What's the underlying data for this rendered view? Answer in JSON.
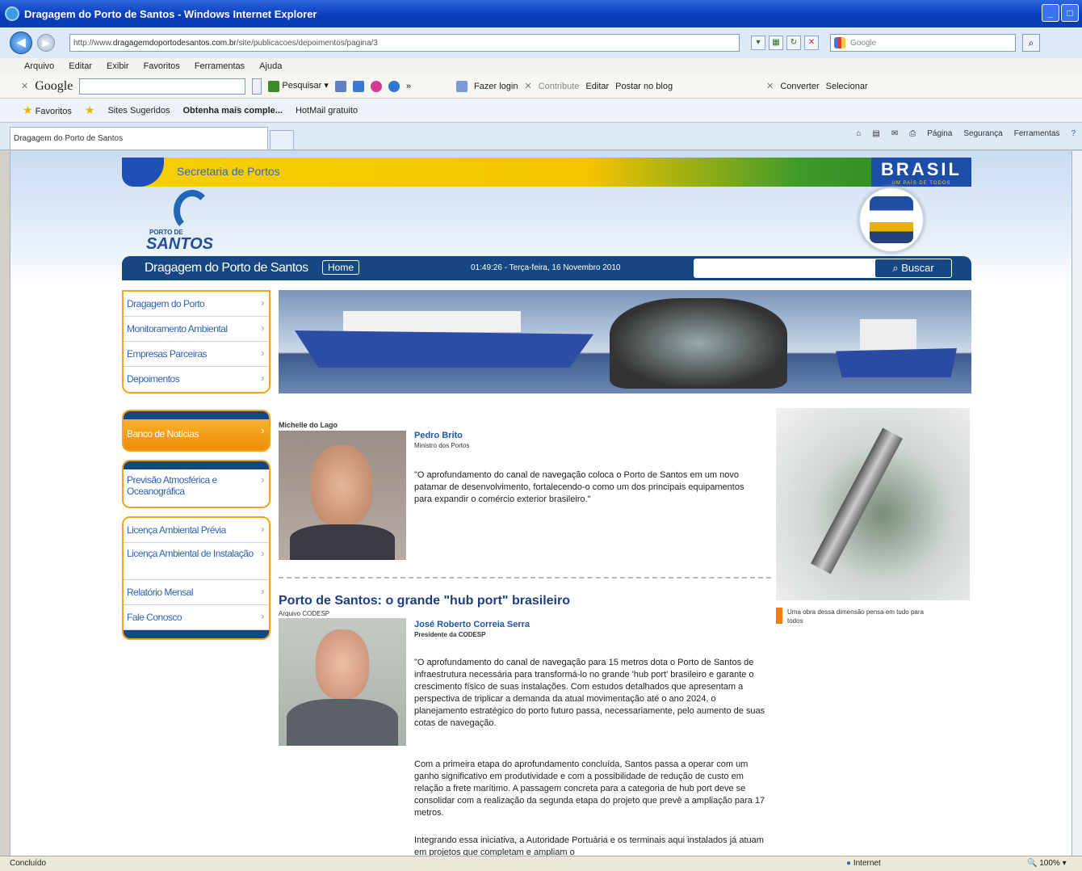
{
  "window": {
    "title": "Dragagem do Porto de Santos - Windows Internet Explorer"
  },
  "address": {
    "url_prefix": "http://www.",
    "url_host": "dragagemdoportodesantos.com.br",
    "url_path": "/site/publicacoes/depoimentos/pagina/3",
    "search_placeholder": "Google"
  },
  "menu": [
    "Arquivo",
    "Editar",
    "Exibir",
    "Favoritos",
    "Ferramentas",
    "Ajuda"
  ],
  "google_toolbar": {
    "logo": "Google",
    "search_label": "Pesquisar",
    "login": "Fazer login",
    "contribute": "Contribute",
    "edit": "Editar",
    "blog": "Postar no blog",
    "convert": "Converter",
    "select": "Selecionar"
  },
  "favorites": {
    "label": "Favoritos",
    "items": [
      "Sites Sugeridos",
      "Obtenha mais comple...",
      "HotMail gratuito"
    ]
  },
  "tab": {
    "title": "Dragagem do Porto de Santos"
  },
  "commandbar": [
    "Página",
    "Segurança",
    "Ferramentas"
  ],
  "site": {
    "ministry": "Secretaria de Portos",
    "brasil": "BRASIL",
    "brasil_tagline": "UM PAÍS DE TODOS",
    "logo_small": "PORTO DE",
    "logo_big": "SANTOS",
    "nav_title": "Dragagem do Porto de Santos",
    "home": "Home",
    "datetime": "01:49:26 - Terça-feira, 16 Novembro 2010",
    "search_button": "Buscar"
  },
  "sidebar": {
    "group1": [
      "Dragagem do Porto",
      "Monitoramento Ambiental",
      "Empresas Parceiras",
      "Depoimentos"
    ],
    "highlight": "Banco de Notícias",
    "group2": [
      "Previsão Atmosférica e Oceanográfica"
    ],
    "group3": [
      "Licença Ambiental Prévia",
      "Licença Ambiental de Instalação",
      "Relatório Mensal",
      "Fale Conosco"
    ]
  },
  "article1": {
    "photo_credit": "Michelle do Lago",
    "name": "Pedro Brito",
    "role": "Ministro dos Portos",
    "quote": "\"O aprofundamento do canal de navegação coloca o Porto de Santos em um novo patamar de desenvolvimento, fortalecendo-o como um dos principais equipamentos para expandir o comércio exterior brasileiro.\""
  },
  "article2": {
    "headline": "Porto de Santos: o grande \"hub port\" brasileiro",
    "source": "Arquivo CODESP",
    "name": "José Roberto Correia Serra",
    "role": "Presidente da CODESP",
    "p1": "\"O aprofundamento do canal de navegação para 15 metros dota o Porto de Santos de infraestrutura necessária para transformá-lo no grande 'hub port' brasileiro e garante o crescimento físico de suas instalações. Com estudos detalhados que apresentam a perspectiva de triplicar a demanda da atual movimentação até o ano 2024, o planejamento estratégico do porto futuro passa, necessariamente, pelo aumento de suas cotas de navegação.",
    "p2": "Com a primeira etapa do aprofundamento concluída, Santos passa a operar com um ganho significativo em produtividade e com a possibilidade de redução de custo em relação a frete marítimo. A passagem concreta para a categoria de hub port deve se consolidar com a realização da segunda etapa do projeto que prevê a ampliação para 17 metros.",
    "p3": "Integrando essa iniciativa, a Autoridade Portuária e os terminais aqui instalados já atuam em projetos que completam e ampliam o"
  },
  "right_caption": "Uma obra dessa dimensão pensa em tudo para todos",
  "status": {
    "left": "Concluído",
    "zone": "Internet",
    "zoom": "100%"
  }
}
